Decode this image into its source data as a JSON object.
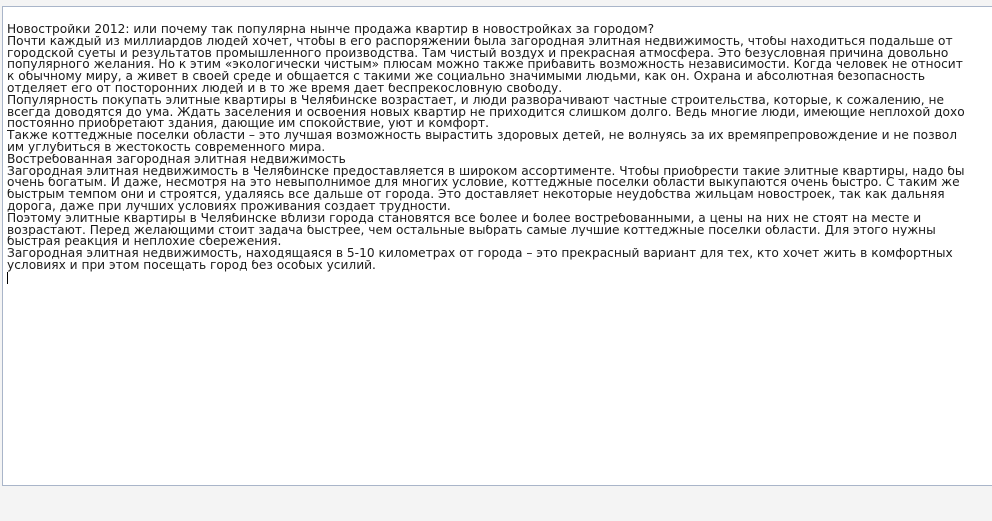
{
  "editor": {
    "lines": [
      "Новостройки 2012: или почему так популярна нынче продажа квартир в новостройках за городом?",
      "Почти каждый из миллиардов людей хочет, чтобы в его распоряжении была загородная элитная недвижимость, чтобы находиться подальше от",
      "городской суеты и результатов промышленного производства. Там чистый воздух и прекрасная атмосфера. Это безусловная причина довольно",
      "популярного желания. Но к этим «экологически чистым» плюсам можно также прибавить возможность независимости. Когда человек не относит",
      "к обычному миру, а живет в своей среде и общается с такими же социально значимыми людьми, как он. Охрана и абсолютная безопасность",
      "отделяет его от посторонних людей и в то же время дает беспрекословную свободу.",
      "Популярность покупать элитные квартиры в Челябинске возрастает, и люди разворачивают частные строительства, которые, к сожалению, не",
      "всегда доводятся до ума. Ждать заселения и освоения новых квартир не приходится слишком долго. Ведь многие люди, имеющие неплохой дохо",
      "постоянно приобретают здания, дающие им спокойствие, уют и комфорт.",
      "Также коттеджные поселки области – это лучшая возможность вырастить здоровых детей, не волнуясь за их времяпрепровождение и не позвол",
      "им углубиться в жестокость современного мира.",
      "Востребованная загородная элитная недвижимость",
      "Загородная элитная недвижимость в Челябинске предоставляется в широком ассортименте. Чтобы приобрести такие элитные квартиры, надо бы",
      "очень богатым. И даже, несмотря на это невыполнимое для многих условие, коттеджные поселки области выкупаются очень быстро. С таким же",
      "быстрым темпом они и строятся, удаляясь все дальше от города. Это доставляет некоторые неудобства жильцам новостроек, так как дальняя",
      "дорога, даже при лучших условиях проживания создает трудности.",
      "Поэтому элитные квартиры в Челябинске вблизи города становятся все более и более востребованными, а цены на них не стоят на месте и",
      "возрастают. Перед желающими стоит задача быстрее, чем остальные выбрать самые лучшие коттеджные поселки области. Для этого нужны",
      "быстрая реакция и неплохие сбережения.",
      "Загородная элитная недвижимость, находящаяся в 5-10 километрах от города – это прекрасный вариант для тех, кто хочет жить в комфортных",
      "условиях и при этом посещать город без особых усилий."
    ]
  }
}
